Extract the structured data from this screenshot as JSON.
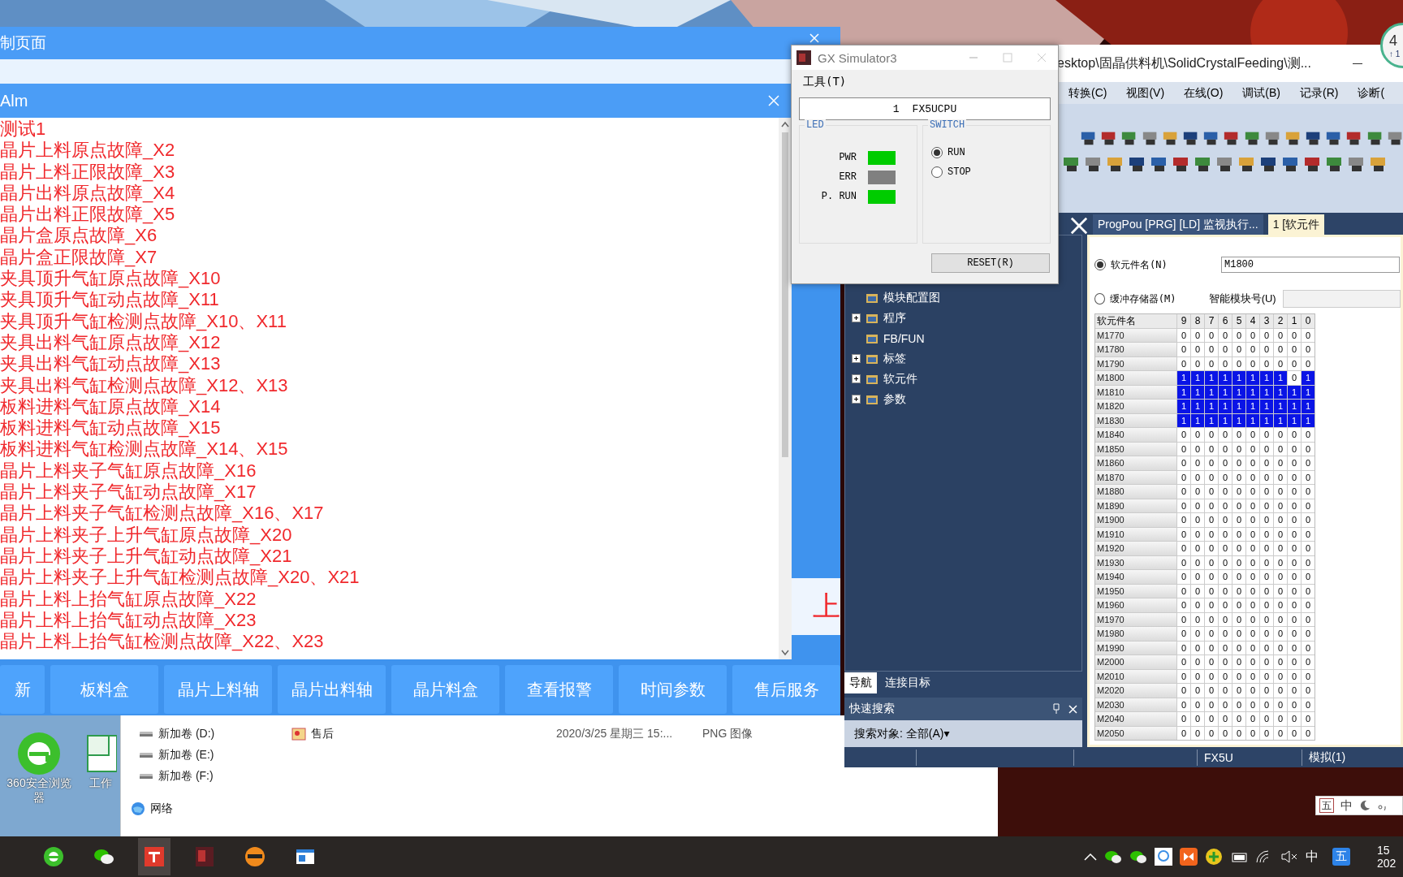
{
  "control_window": {
    "title": "制页面",
    "side_text": "上",
    "buttons": [
      {
        "label": "新"
      },
      {
        "label": "板料盒"
      },
      {
        "label": "晶片上料轴"
      },
      {
        "label": "晶片出料轴"
      },
      {
        "label": "晶片料盒"
      },
      {
        "label": "查看报警"
      },
      {
        "label": "时间参数"
      },
      {
        "label": "售后服务"
      }
    ]
  },
  "alarm_window": {
    "title": "Alm",
    "lines": [
      "测试1",
      "晶片上料原点故障_X2",
      "晶片上料正限故障_X3",
      "晶片出料原点故障_X4",
      "晶片出料正限故障_X5",
      "晶片盒原点故障_X6",
      "晶片盒正限故障_X7",
      "夹具顶升气缸原点故障_X10",
      "夹具顶升气缸动点故障_X11",
      "夹具顶升气缸检测点故障_X10、X11",
      "夹具出料气缸原点故障_X12",
      "夹具出料气缸动点故障_X13",
      "夹具出料气缸检测点故障_X12、X13",
      "板料进料气缸原点故障_X14",
      "板料进料气缸动点故障_X15",
      "板料进料气缸检测点故障_X14、X15",
      "晶片上料夹子气缸原点故障_X16",
      "晶片上料夹子气缸动点故障_X17",
      "晶片上料夹子气缸检测点故障_X16、X17",
      "晶片上料夹子上升气缸原点故障_X20",
      "晶片上料夹子上升气缸动点故障_X21",
      "晶片上料夹子上升气缸检测点故障_X20、X21",
      "晶片上料上抬气缸原点故障_X22",
      "晶片上料上抬气缸动点故障_X23",
      "晶片上料上抬气缸检测点故障_X22、X23"
    ]
  },
  "desktop_icons": [
    {
      "label": "360安全浏览器"
    },
    {
      "label": "工作"
    }
  ],
  "explorer": {
    "drives": [
      "新加卷 (D:)",
      "新加卷 (E:)",
      "新加卷 (F:)"
    ],
    "network": "网络",
    "files": [
      {
        "name": "售后",
        "date": "2020/3/25 星期三 15:...",
        "type": "PNG 图像"
      }
    ]
  },
  "simulator": {
    "title": "GX Simulator3",
    "menu": [
      "工具(T)"
    ],
    "cpu_number": "1",
    "cpu": "FX5UCPU",
    "led_title": "LED",
    "leds": [
      {
        "label": "PWR",
        "color": "#00cc00"
      },
      {
        "label": "ERR",
        "color": "#808080"
      },
      {
        "label": "P. RUN",
        "color": "#00cc00"
      }
    ],
    "switch_title": "SWITCH",
    "switch_options": [
      {
        "label": "RUN",
        "selected": true
      },
      {
        "label": "STOP",
        "selected": false
      }
    ],
    "reset_button": "RESET(R)"
  },
  "gx_works": {
    "title": "esktop\\固晶供料机\\SolidCrystalFeeding\\测...",
    "menu": [
      "转换(C)",
      "视图(V)",
      "在线(O)",
      "调试(B)",
      "记录(R)",
      "诊断("
    ],
    "doc_tabs": [
      {
        "label": "ProgPou [PRG] [LD] 监视执行...",
        "selected": false
      },
      {
        "label": "1 [软元件",
        "selected": true
      }
    ],
    "nav_items": [
      {
        "label": "模块配置图",
        "expandable": false
      },
      {
        "label": "程序",
        "expandable": true
      },
      {
        "label": "FB/FUN",
        "expandable": false
      },
      {
        "label": "标签",
        "expandable": true
      },
      {
        "label": "软元件",
        "expandable": true
      },
      {
        "label": "参数",
        "expandable": true
      }
    ],
    "nav_tabs": [
      {
        "label": "导航",
        "selected": true
      },
      {
        "label": "连接目标",
        "selected": false
      }
    ],
    "quick_search": {
      "title": "快速搜索",
      "scope": "搜索对象: 全部(A)▾"
    },
    "device_monitor": {
      "options": [
        {
          "label": "软元件名(N)",
          "selected": true,
          "value": "M1800"
        },
        {
          "label": "缓冲存储器(M)",
          "selected": false
        }
      ],
      "module_label": "智能模块号(U)",
      "table": {
        "name_header": "软元件名",
        "bit_headers": [
          "9",
          "8",
          "7",
          "6",
          "5",
          "4",
          "3",
          "2",
          "1",
          "0"
        ],
        "rows": [
          {
            "name": "M1770",
            "bits": [
              "0",
              "0",
              "0",
              "0",
              "0",
              "0",
              "0",
              "0",
              "0",
              "0"
            ],
            "on": [
              false,
              false,
              false,
              false,
              false,
              false,
              false,
              false,
              false,
              false
            ]
          },
          {
            "name": "M1780",
            "bits": [
              "0",
              "0",
              "0",
              "0",
              "0",
              "0",
              "0",
              "0",
              "0",
              "0"
            ],
            "on": [
              false,
              false,
              false,
              false,
              false,
              false,
              false,
              false,
              false,
              false
            ]
          },
          {
            "name": "M1790",
            "bits": [
              "0",
              "0",
              "0",
              "0",
              "0",
              "0",
              "0",
              "0",
              "0",
              "0"
            ],
            "on": [
              false,
              false,
              false,
              false,
              false,
              false,
              false,
              false,
              false,
              false
            ]
          },
          {
            "name": "M1800",
            "bits": [
              "1",
              "1",
              "1",
              "1",
              "1",
              "1",
              "1",
              "1",
              "0",
              "1"
            ],
            "on": [
              true,
              true,
              true,
              true,
              true,
              true,
              true,
              true,
              false,
              true
            ]
          },
          {
            "name": "M1810",
            "bits": [
              "1",
              "1",
              "1",
              "1",
              "1",
              "1",
              "1",
              "1",
              "1",
              "1"
            ],
            "on": [
              true,
              true,
              true,
              true,
              true,
              true,
              true,
              true,
              true,
              true
            ]
          },
          {
            "name": "M1820",
            "bits": [
              "1",
              "1",
              "1",
              "1",
              "1",
              "1",
              "1",
              "1",
              "1",
              "1"
            ],
            "on": [
              true,
              true,
              true,
              true,
              true,
              true,
              true,
              true,
              true,
              true
            ]
          },
          {
            "name": "M1830",
            "bits": [
              "1",
              "1",
              "1",
              "1",
              "1",
              "1",
              "1",
              "1",
              "1",
              "1"
            ],
            "on": [
              true,
              true,
              true,
              true,
              true,
              true,
              true,
              true,
              true,
              true
            ]
          },
          {
            "name": "M1840",
            "bits": [
              "0",
              "0",
              "0",
              "0",
              "0",
              "0",
              "0",
              "0",
              "0",
              "0"
            ],
            "on": [
              false,
              false,
              false,
              false,
              false,
              false,
              false,
              false,
              false,
              false
            ]
          },
          {
            "name": "M1850",
            "bits": [
              "0",
              "0",
              "0",
              "0",
              "0",
              "0",
              "0",
              "0",
              "0",
              "0"
            ],
            "on": [
              false,
              false,
              false,
              false,
              false,
              false,
              false,
              false,
              false,
              false
            ]
          },
          {
            "name": "M1860",
            "bits": [
              "0",
              "0",
              "0",
              "0",
              "0",
              "0",
              "0",
              "0",
              "0",
              "0"
            ],
            "on": [
              false,
              false,
              false,
              false,
              false,
              false,
              false,
              false,
              false,
              false
            ]
          },
          {
            "name": "M1870",
            "bits": [
              "0",
              "0",
              "0",
              "0",
              "0",
              "0",
              "0",
              "0",
              "0",
              "0"
            ],
            "on": [
              false,
              false,
              false,
              false,
              false,
              false,
              false,
              false,
              false,
              false
            ]
          },
          {
            "name": "M1880",
            "bits": [
              "0",
              "0",
              "0",
              "0",
              "0",
              "0",
              "0",
              "0",
              "0",
              "0"
            ],
            "on": [
              false,
              false,
              false,
              false,
              false,
              false,
              false,
              false,
              false,
              false
            ]
          },
          {
            "name": "M1890",
            "bits": [
              "0",
              "0",
              "0",
              "0",
              "0",
              "0",
              "0",
              "0",
              "0",
              "0"
            ],
            "on": [
              false,
              false,
              false,
              false,
              false,
              false,
              false,
              false,
              false,
              false
            ]
          },
          {
            "name": "M1900",
            "bits": [
              "0",
              "0",
              "0",
              "0",
              "0",
              "0",
              "0",
              "0",
              "0",
              "0"
            ],
            "on": [
              false,
              false,
              false,
              false,
              false,
              false,
              false,
              false,
              false,
              false
            ]
          },
          {
            "name": "M1910",
            "bits": [
              "0",
              "0",
              "0",
              "0",
              "0",
              "0",
              "0",
              "0",
              "0",
              "0"
            ],
            "on": [
              false,
              false,
              false,
              false,
              false,
              false,
              false,
              false,
              false,
              false
            ]
          },
          {
            "name": "M1920",
            "bits": [
              "0",
              "0",
              "0",
              "0",
              "0",
              "0",
              "0",
              "0",
              "0",
              "0"
            ],
            "on": [
              false,
              false,
              false,
              false,
              false,
              false,
              false,
              false,
              false,
              false
            ]
          },
          {
            "name": "M1930",
            "bits": [
              "0",
              "0",
              "0",
              "0",
              "0",
              "0",
              "0",
              "0",
              "0",
              "0"
            ],
            "on": [
              false,
              false,
              false,
              false,
              false,
              false,
              false,
              false,
              false,
              false
            ]
          },
          {
            "name": "M1940",
            "bits": [
              "0",
              "0",
              "0",
              "0",
              "0",
              "0",
              "0",
              "0",
              "0",
              "0"
            ],
            "on": [
              false,
              false,
              false,
              false,
              false,
              false,
              false,
              false,
              false,
              false
            ]
          },
          {
            "name": "M1950",
            "bits": [
              "0",
              "0",
              "0",
              "0",
              "0",
              "0",
              "0",
              "0",
              "0",
              "0"
            ],
            "on": [
              false,
              false,
              false,
              false,
              false,
              false,
              false,
              false,
              false,
              false
            ]
          },
          {
            "name": "M1960",
            "bits": [
              "0",
              "0",
              "0",
              "0",
              "0",
              "0",
              "0",
              "0",
              "0",
              "0"
            ],
            "on": [
              false,
              false,
              false,
              false,
              false,
              false,
              false,
              false,
              false,
              false
            ]
          },
          {
            "name": "M1970",
            "bits": [
              "0",
              "0",
              "0",
              "0",
              "0",
              "0",
              "0",
              "0",
              "0",
              "0"
            ],
            "on": [
              false,
              false,
              false,
              false,
              false,
              false,
              false,
              false,
              false,
              false
            ]
          },
          {
            "name": "M1980",
            "bits": [
              "0",
              "0",
              "0",
              "0",
              "0",
              "0",
              "0",
              "0",
              "0",
              "0"
            ],
            "on": [
              false,
              false,
              false,
              false,
              false,
              false,
              false,
              false,
              false,
              false
            ]
          },
          {
            "name": "M1990",
            "bits": [
              "0",
              "0",
              "0",
              "0",
              "0",
              "0",
              "0",
              "0",
              "0",
              "0"
            ],
            "on": [
              false,
              false,
              false,
              false,
              false,
              false,
              false,
              false,
              false,
              false
            ]
          },
          {
            "name": "M2000",
            "bits": [
              "0",
              "0",
              "0",
              "0",
              "0",
              "0",
              "0",
              "0",
              "0",
              "0"
            ],
            "on": [
              false,
              false,
              false,
              false,
              false,
              false,
              false,
              false,
              false,
              false
            ]
          },
          {
            "name": "M2010",
            "bits": [
              "0",
              "0",
              "0",
              "0",
              "0",
              "0",
              "0",
              "0",
              "0",
              "0"
            ],
            "on": [
              false,
              false,
              false,
              false,
              false,
              false,
              false,
              false,
              false,
              false
            ]
          },
          {
            "name": "M2020",
            "bits": [
              "0",
              "0",
              "0",
              "0",
              "0",
              "0",
              "0",
              "0",
              "0",
              "0"
            ],
            "on": [
              false,
              false,
              false,
              false,
              false,
              false,
              false,
              false,
              false,
              false
            ]
          },
          {
            "name": "M2030",
            "bits": [
              "0",
              "0",
              "0",
              "0",
              "0",
              "0",
              "0",
              "0",
              "0",
              "0"
            ],
            "on": [
              false,
              false,
              false,
              false,
              false,
              false,
              false,
              false,
              false,
              false
            ]
          },
          {
            "name": "M2040",
            "bits": [
              "0",
              "0",
              "0",
              "0",
              "0",
              "0",
              "0",
              "0",
              "0",
              "0"
            ],
            "on": [
              false,
              false,
              false,
              false,
              false,
              false,
              false,
              false,
              false,
              false
            ]
          },
          {
            "name": "M2050",
            "bits": [
              "0",
              "0",
              "0",
              "0",
              "0",
              "0",
              "0",
              "0",
              "0",
              "0"
            ],
            "on": [
              false,
              false,
              false,
              false,
              false,
              false,
              false,
              false,
              false,
              false
            ]
          }
        ]
      }
    },
    "status_bar": [
      "FX5U",
      "模拟(1)"
    ]
  },
  "notification": {
    "count": "4",
    "sub": "↑ 1"
  },
  "ime_bar": {
    "mode": "五",
    "language": "中"
  },
  "taskbar": {
    "input_language": "中",
    "input_mode": "五",
    "clock_time": "15",
    "clock_date": "202"
  }
}
